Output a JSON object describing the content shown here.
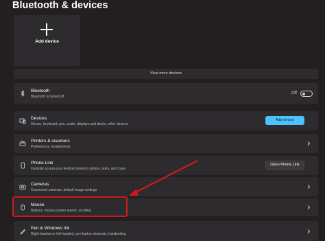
{
  "page": {
    "title": "Bluetooth & devices"
  },
  "add_device_tile": {
    "label": "Add device"
  },
  "view_more": {
    "label": "View more devices"
  },
  "bluetooth": {
    "title": "Bluetooth",
    "subtitle": "Bluetooth is turned off",
    "toggle_label": "Off",
    "toggle_on": false
  },
  "rows": {
    "devices": {
      "title": "Devices",
      "subtitle": "Mouse, keyboard, pen, audio, displays and docks, other devices",
      "button": "Add device"
    },
    "printers": {
      "title": "Printers & scanners",
      "subtitle": "Preferences, troubleshoot"
    },
    "phone_link": {
      "title": "Phone Link",
      "subtitle": "Instantly access your Android device's photos, texts, and more",
      "button": "Open Phone Link"
    },
    "cameras": {
      "title": "Cameras",
      "subtitle": "Connected cameras, default image settings"
    },
    "mouse": {
      "title": "Mouse",
      "subtitle": "Buttons, mouse pointer speed, scrolling"
    },
    "pen": {
      "title": "Pen & Windows Ink",
      "subtitle": "Right-handed or left-handed, pen button shortcuts, handwriting"
    }
  },
  "colors": {
    "accent": "#4cc2ff",
    "annotation": "#d0191e",
    "background": "#231f20",
    "card": "#2d2b2e"
  }
}
